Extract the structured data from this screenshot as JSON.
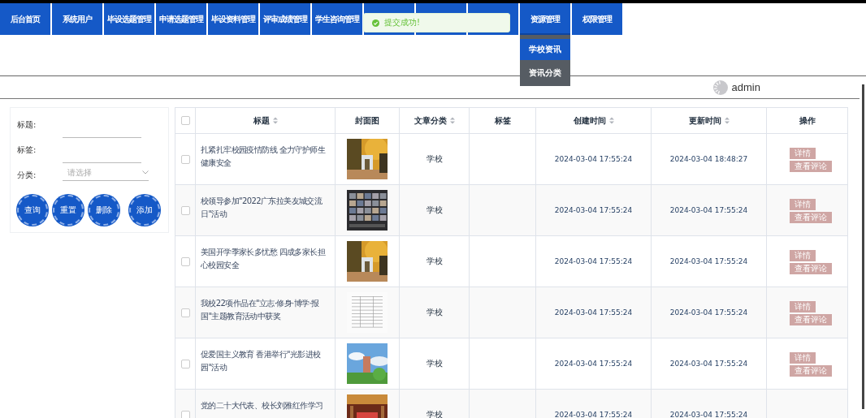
{
  "nav": [
    {
      "kind": "tab",
      "label": "后台首页",
      "selected": false
    },
    {
      "kind": "tab",
      "label": "系统用户",
      "selected": false
    },
    {
      "kind": "tab",
      "label": "毕设选题管理",
      "selected": false
    },
    {
      "kind": "tab",
      "label": "申请选题管理",
      "selected": false
    },
    {
      "kind": "tab",
      "label": "毕设资料管理",
      "selected": false
    },
    {
      "kind": "tab",
      "label": "评审成绩管理",
      "selected": false
    },
    {
      "kind": "tab",
      "label": "学生咨询管理",
      "selected": false
    },
    {
      "kind": "covered"
    },
    {
      "kind": "covered"
    },
    {
      "kind": "covered"
    },
    {
      "kind": "tab",
      "label": "资源管理",
      "selected": true,
      "menu": [
        {
          "label": "学校资讯",
          "selected": false
        },
        {
          "label": "资讯分类",
          "selected": true
        }
      ]
    },
    {
      "kind": "tab",
      "label": "权限管理",
      "selected": false
    }
  ],
  "toast": {
    "text": "提交成功!"
  },
  "user": {
    "name": "admin"
  },
  "filters": [
    {
      "kind": "text",
      "label": "标题:"
    },
    {
      "kind": "text",
      "label": "标签:"
    },
    {
      "kind": "select",
      "label": "分类:",
      "placeholder": "请选择"
    }
  ],
  "filter_buttons": [
    "查询",
    "重置",
    "删除",
    "添加"
  ],
  "table": {
    "select_all": {
      "checked": false
    },
    "columns": [
      {
        "label": "标题",
        "sortable": true
      },
      {
        "label": "封面图",
        "sortable": false
      },
      {
        "label": "文章分类",
        "sortable": true
      },
      {
        "label": "标签",
        "sortable": false
      },
      {
        "label": "创建时间",
        "sortable": true
      },
      {
        "label": "更新时间",
        "sortable": true
      },
      {
        "label": "操作",
        "sortable": false
      }
    ],
    "rows": [
      {
        "checked": false,
        "title": "扎紧扎牢校园疫情防线 全力守护师生健康安全",
        "category": "学校",
        "created": "2024-03-04 17:55:24",
        "updated": "2024-03-04 18:48:27",
        "actions": [
          "详情",
          "查看评论"
        ]
      },
      {
        "checked": false,
        "title": "校领导参加\"2022广东拉美友城交流日\"活动",
        "category": "学校",
        "created": "2024-03-04 17:55:24",
        "updated": "2024-03-04 17:55:24",
        "actions": [
          "详情",
          "查看评论"
        ]
      },
      {
        "checked": false,
        "title": "美国开学季家长多忧愁 四成多家长担心校园安全",
        "category": "学校",
        "created": "2024-03-04 17:55:24",
        "updated": "2024-03-04 17:55:24",
        "actions": [
          "详情",
          "查看评论"
        ]
      },
      {
        "checked": false,
        "title": "我校22项作品在\"立志·修身·博学·报国\"主题教育活动中获奖",
        "category": "学校",
        "created": "2024-03-04 17:55:24",
        "updated": "2024-03-04 17:55:24",
        "actions": [
          "详情",
          "查看评论"
        ]
      },
      {
        "checked": false,
        "title": "促爱国主义教育 香港举行\"光影进校园\"活动",
        "category": "学校",
        "created": "2024-03-04 17:55:24",
        "updated": "2024-03-04 17:55:24",
        "actions": [
          "详情",
          "查看评论"
        ]
      },
      {
        "checked": false,
        "title": "党的二十大代表、校长刘雅红作学习",
        "category": "学校",
        "created": "2024-03-04 17:55:24",
        "updated": "2024-03-04 17:55:24"
      }
    ]
  }
}
